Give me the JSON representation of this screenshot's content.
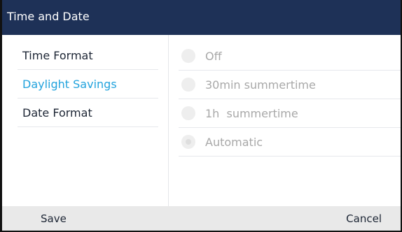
{
  "window": {
    "title": "Time and Date"
  },
  "nav": {
    "items": [
      {
        "label": "Time Format",
        "active": false
      },
      {
        "label": "Daylight Savings",
        "active": true
      },
      {
        "label": "Date Format",
        "active": false
      }
    ]
  },
  "options": {
    "items": [
      {
        "label": "Off",
        "selected": false
      },
      {
        "label": "30min summertime",
        "selected": false
      },
      {
        "label": "1h  summertime",
        "selected": false
      },
      {
        "label": "Automatic",
        "selected": true
      }
    ]
  },
  "softkeys": {
    "save_label": "Save",
    "cancel_label": "Cancel"
  },
  "colors": {
    "title_bar": "#1e3157",
    "active_item": "#22a3dd",
    "bottom_bar": "#e9e9e9",
    "disabled_text": "#a8a8a8"
  }
}
